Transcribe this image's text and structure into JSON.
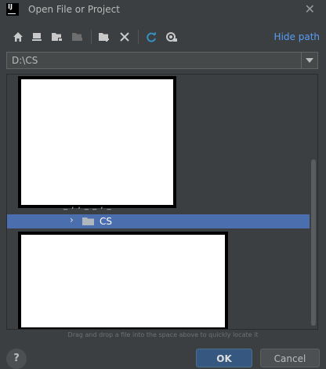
{
  "window": {
    "title": "Open File or Project",
    "app_icon_text": "IJ"
  },
  "toolbar": {
    "icons": [
      "home-icon",
      "desktop-icon",
      "project-folder-icon",
      "module-folder-icon",
      "new-folder-icon",
      "delete-icon",
      "refresh-icon",
      "show-hidden-icon"
    ],
    "hide_path_label": "Hide path"
  },
  "path": {
    "value": "D:\\CS"
  },
  "tree": {
    "selected_item": "CS",
    "partial_item": "_ ,  , _  _ , _"
  },
  "hint_text": "Drag and drop a file into the space above to quickly locate it",
  "buttons": {
    "help": "?",
    "ok": "OK",
    "cancel": "Cancel"
  },
  "colors": {
    "background": "#3c3f41",
    "selection": "#4b6eaf",
    "link": "#589df6",
    "refresh": "#3592c4"
  }
}
